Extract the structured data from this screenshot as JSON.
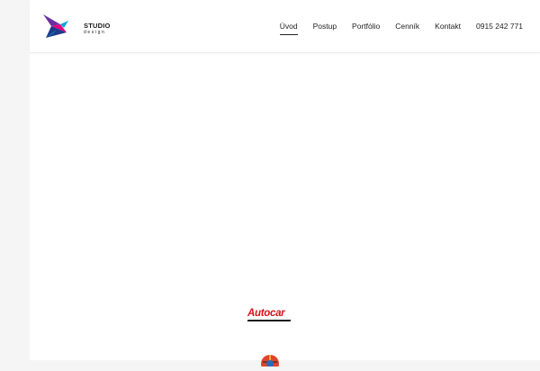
{
  "header": {
    "logo": {
      "main_text": "STUDIO",
      "sub_text": "design"
    },
    "nav": [
      {
        "label": "Úvod",
        "active": true
      },
      {
        "label": "Postup",
        "active": false
      },
      {
        "label": "Portfólio",
        "active": false
      },
      {
        "label": "Cenník",
        "active": false
      },
      {
        "label": "Kontakt",
        "active": false
      },
      {
        "label": "0915 242 771",
        "active": false
      }
    ]
  },
  "brands": {
    "autocar": "Autocar"
  },
  "colors": {
    "logo_magenta": "#e6007e",
    "logo_blue": "#1e3a8a",
    "logo_cyan": "#00a6d6",
    "logo_purple": "#6b2fa0",
    "autocar_red": "#d4141a"
  }
}
